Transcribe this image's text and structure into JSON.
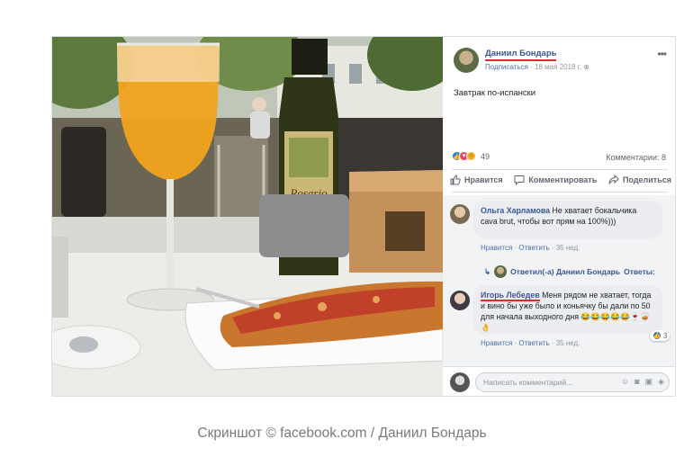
{
  "post": {
    "author": "Даниил Бондарь",
    "follow_label": "Подписаться",
    "date": "18 мая 2018 г.",
    "text": "Завтрак по-испански",
    "reactions_count": "49",
    "comments_count_label": "Комментарии: 8"
  },
  "actions": {
    "like": "Нравится",
    "comment": "Комментировать",
    "share": "Поделиться"
  },
  "comments": [
    {
      "name": "Ольга Харламова",
      "text": "Не хватает бокальчика cava brut, чтобы вот прям на 100%)))",
      "like_label": "Нравится",
      "reply_label": "Ответить",
      "time": "35 нед."
    },
    {
      "name": "Игорь Лебедев",
      "text": "Меня рядом не хватает, тогда и вино бы уже было и коньячку бы дали по 50 для начала выходного дня 😂😂😂😂😂🍷🥃👌",
      "like_label": "Нравится",
      "reply_label": "Ответить",
      "time": "35 нед.",
      "likes": "3"
    }
  ],
  "reply": {
    "label": "Ответил(-а) Даниил Бондарь · Ответы: 1",
    "prefix": "Ответил(-а) Даниил Бондарь",
    "suffix": "Ответы:"
  },
  "composer": {
    "placeholder": "Написать комментарий..."
  },
  "photo": {
    "bottle_label": "Rosario"
  },
  "caption": "Скриншот © facebook.com / Даниил Бондарь",
  "colors": {
    "link": "#385898",
    "like_blue": "#1877f2",
    "underline_red": "#d93025"
  }
}
